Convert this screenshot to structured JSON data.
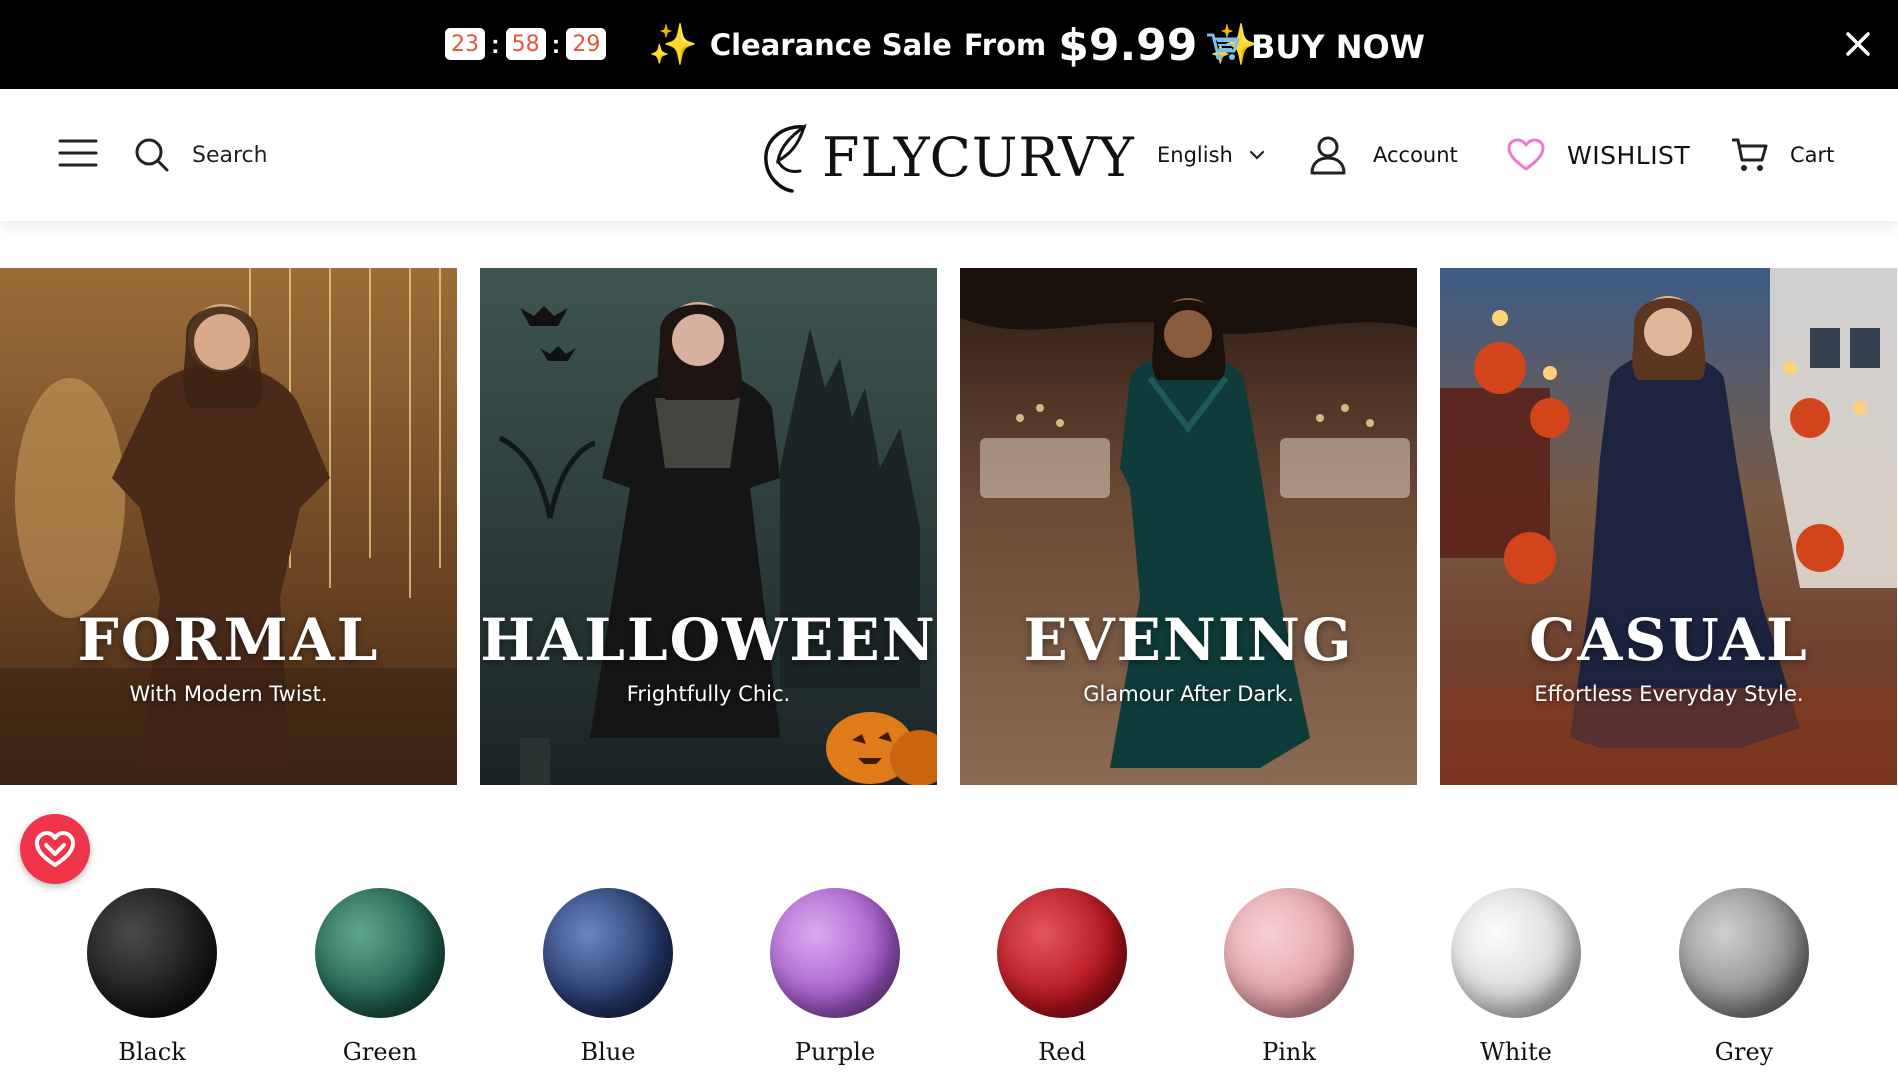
{
  "promo": {
    "timer": {
      "hours": "23",
      "minutes": "58",
      "seconds": "29",
      "separator": ":"
    },
    "sale_text": "Clearance Sale",
    "from_text": "From",
    "price": "$9.99",
    "buy_label": "BUY NOW",
    "colors": {
      "background": "#000000",
      "timer_text": "#e8533b",
      "sparkle": "#f6c542"
    }
  },
  "header": {
    "search_label": "Search",
    "brand": "FLYCURVY",
    "language": "English",
    "account_label": "Account",
    "wishlist_label": "WISHLIST",
    "cart_label": "Cart",
    "wishlist_icon_color": "#f07ad0"
  },
  "tiles": [
    {
      "title": "FORMAL",
      "subtitle": "With Modern Twist."
    },
    {
      "title": "HALLOWEEN",
      "subtitle": "Frightfully Chic."
    },
    {
      "title": "EVENING",
      "subtitle": "Glamour After Dark."
    },
    {
      "title": "CASUAL",
      "subtitle": "Effortless Everyday Style."
    }
  ],
  "badge": {
    "icon": "chevron-down-heart-icon",
    "color": "#f0354b"
  },
  "colors": [
    {
      "name": "Black",
      "hex": "#1b1b1b"
    },
    {
      "name": "Green",
      "hex": "#1f5f4e"
    },
    {
      "name": "Blue",
      "hex": "#24386a"
    },
    {
      "name": "Purple",
      "hex": "#a45cc9"
    },
    {
      "name": "Red",
      "hex": "#b5141e"
    },
    {
      "name": "Pink",
      "hex": "#e3a0a6"
    },
    {
      "name": "White",
      "hex": "#d9d9d9"
    },
    {
      "name": "Grey",
      "hex": "#8e8e90"
    }
  ]
}
